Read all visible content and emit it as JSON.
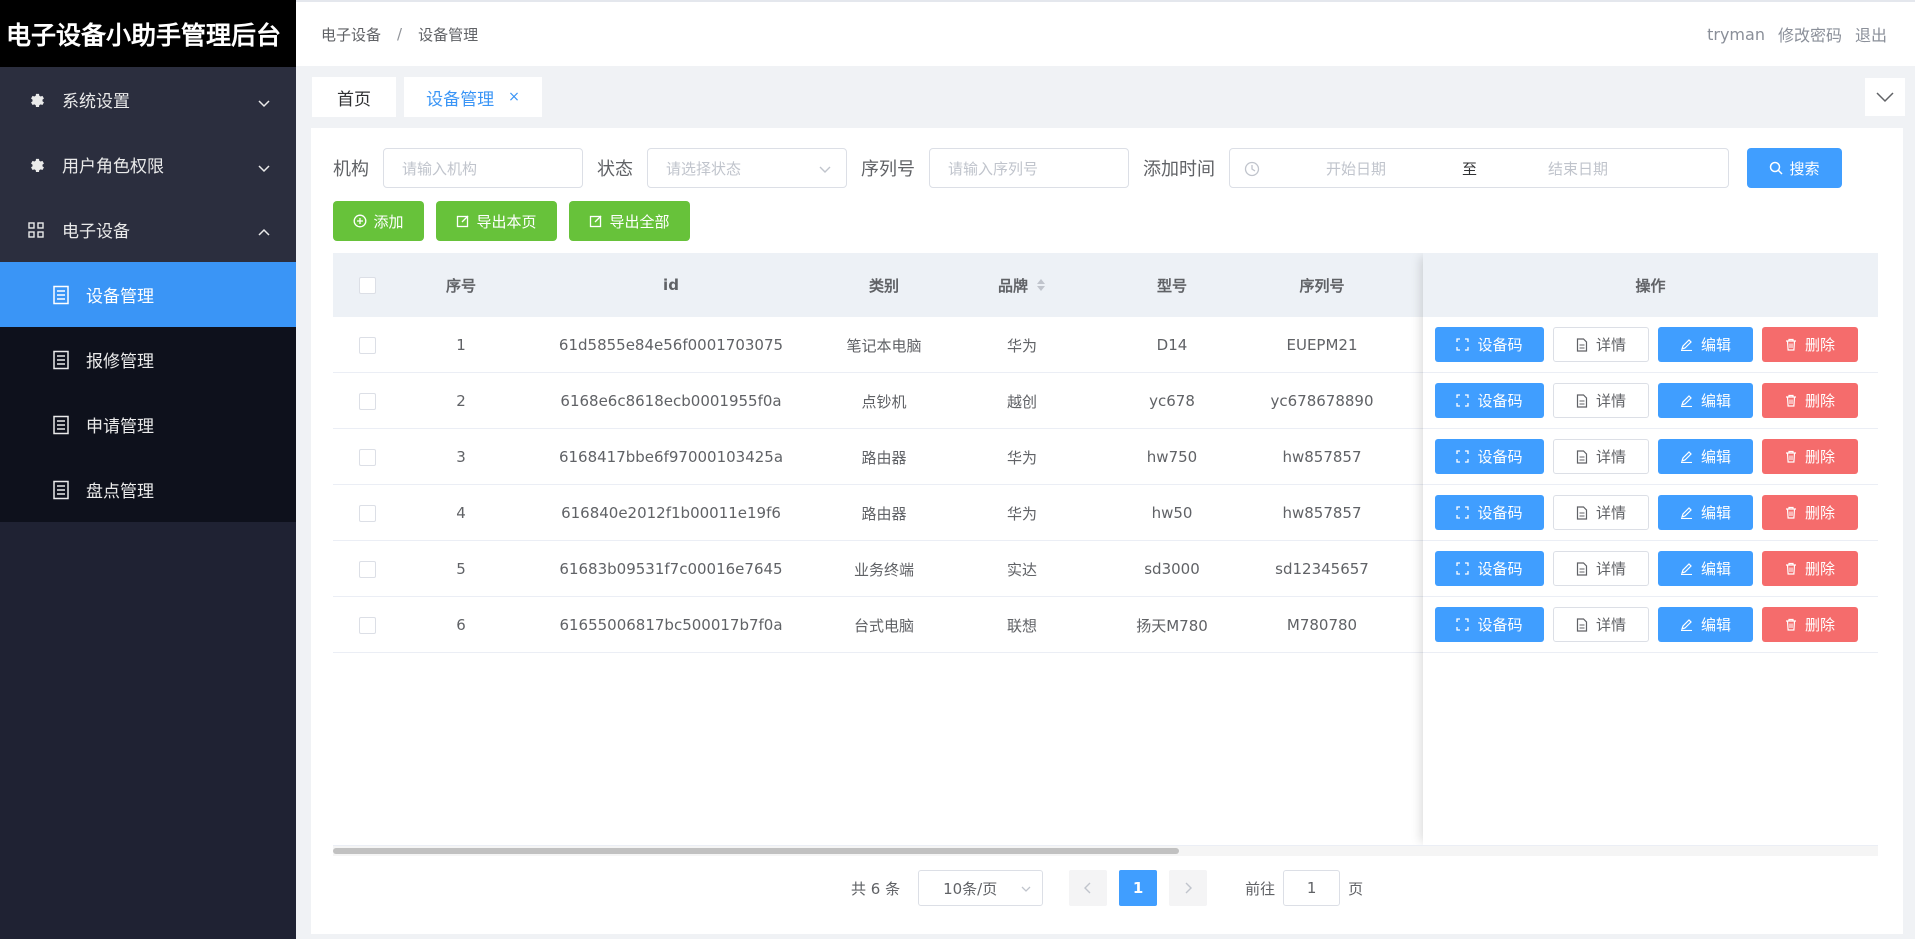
{
  "app": {
    "title": "电子设备小助手管理后台"
  },
  "sidebar": {
    "menus": [
      {
        "label": "系统设置",
        "icon": "gear-icon",
        "expanded": false
      },
      {
        "label": "用户角色权限",
        "icon": "gear-icon",
        "expanded": false
      },
      {
        "label": "电子设备",
        "icon": "grid-icon",
        "expanded": true
      }
    ],
    "submenu": [
      {
        "label": "设备管理",
        "active": true
      },
      {
        "label": "报修管理",
        "active": false
      },
      {
        "label": "申请管理",
        "active": false
      },
      {
        "label": "盘点管理",
        "active": false
      }
    ]
  },
  "header": {
    "breadcrumb": [
      "电子设备",
      "设备管理"
    ],
    "separator": "/",
    "user": "tryman",
    "change_password": "修改密码",
    "logout": "退出"
  },
  "tabs": {
    "home": "首页",
    "active": "设备管理",
    "close": "×"
  },
  "filters": {
    "org_label": "机构",
    "org_placeholder": "请输入机构",
    "status_label": "状态",
    "status_placeholder": "请选择状态",
    "serial_label": "序列号",
    "serial_placeholder": "请输入序列号",
    "time_label": "添加时间",
    "start_placeholder": "开始日期",
    "to": "至",
    "end_placeholder": "结束日期",
    "search": "搜索"
  },
  "actions": {
    "add": "添加",
    "export_page": "导出本页",
    "export_all": "导出全部"
  },
  "table": {
    "headers": {
      "index": "序号",
      "id": "id",
      "category": "类别",
      "brand": "品牌",
      "model": "型号",
      "serial": "序列号",
      "ops": "操作"
    },
    "rows": [
      {
        "index": "1",
        "id": "61d5855e84e56f0001703075",
        "category": "笔记本电脑",
        "brand": "华为",
        "model": "D14",
        "serial": "EUEPM21"
      },
      {
        "index": "2",
        "id": "6168e6c8618ecb0001955f0a",
        "category": "点钞机",
        "brand": "越创",
        "model": "yc678",
        "serial": "yc678678890"
      },
      {
        "index": "3",
        "id": "6168417bbe6f97000103425a",
        "category": "路由器",
        "brand": "华为",
        "model": "hw750",
        "serial": "hw857857"
      },
      {
        "index": "4",
        "id": "616840e2012f1b00011e19f6",
        "category": "路由器",
        "brand": "华为",
        "model": "hw50",
        "serial": "hw857857"
      },
      {
        "index": "5",
        "id": "61683b09531f7c00016e7645",
        "category": "业务终端",
        "brand": "实达",
        "model": "sd3000",
        "serial": "sd12345657"
      },
      {
        "index": "6",
        "id": "61655006817bc500017b7f0a",
        "category": "台式电脑",
        "brand": "联想",
        "model": "扬天M780",
        "serial": "M780780"
      }
    ],
    "ops": {
      "code": "设备码",
      "detail": "详情",
      "edit": "编辑",
      "delete": "删除"
    }
  },
  "pagination": {
    "total": "共 6 条",
    "page_size": "10条/页",
    "current": "1",
    "goto": "前往",
    "goto_value": "1",
    "page_unit": "页"
  },
  "colors": {
    "primary": "#409eff",
    "success": "#67c23a",
    "danger": "#f56c6c",
    "sidebar_active": "#3a95f6"
  }
}
